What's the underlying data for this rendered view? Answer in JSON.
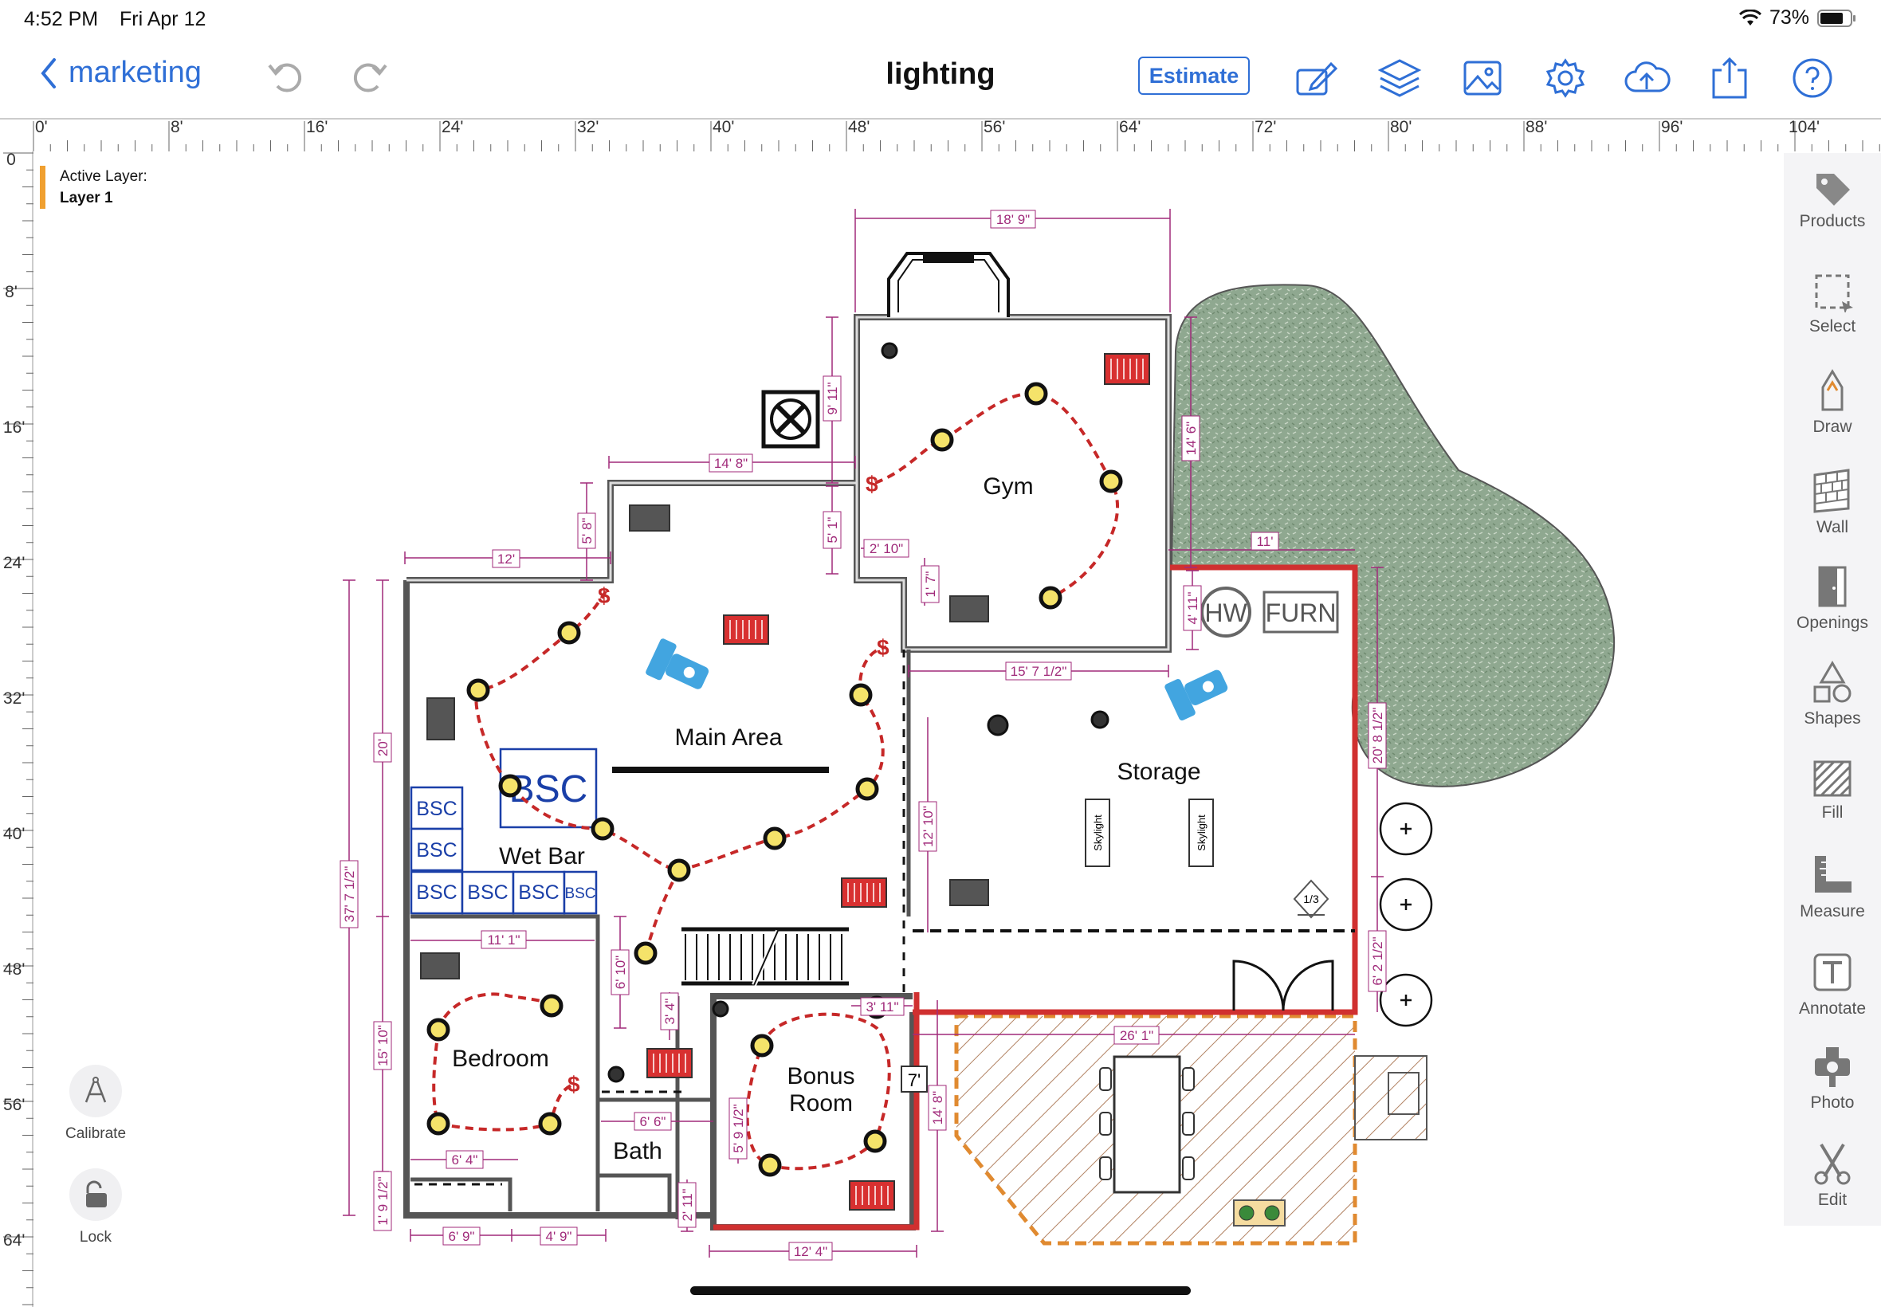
{
  "status_bar": {
    "time": "4:52 PM",
    "date": "Fri Apr 12",
    "battery": "73%"
  },
  "header": {
    "back_label": "marketing",
    "title": "lighting",
    "estimate_label": "Estimate"
  },
  "ruler": {
    "top_labels": [
      "0'",
      "8'",
      "16'",
      "24'",
      "32'",
      "40'",
      "48'",
      "56'",
      "64'",
      "72'",
      "80'",
      "88'",
      "96'",
      "104'"
    ],
    "left_labels": [
      "0",
      "8'",
      "16'",
      "24'",
      "32'",
      "40'",
      "48'",
      "56'",
      "64'"
    ]
  },
  "layer": {
    "caption": "Active Layer:",
    "name": "Layer 1"
  },
  "tools": [
    {
      "label": "Products",
      "icon": "tag-icon"
    },
    {
      "label": "Select",
      "icon": "select-icon"
    },
    {
      "label": "Draw",
      "icon": "pen-icon"
    },
    {
      "label": "Wall",
      "icon": "wall-icon"
    },
    {
      "label": "Openings",
      "icon": "door-icon"
    },
    {
      "label": "Shapes",
      "icon": "shapes-icon"
    },
    {
      "label": "Fill",
      "icon": "fill-icon"
    },
    {
      "label": "Measure",
      "icon": "ruler-icon"
    },
    {
      "label": "Annotate",
      "icon": "text-icon"
    },
    {
      "label": "Photo",
      "icon": "camera-icon"
    },
    {
      "label": "Edit",
      "icon": "scissors-icon"
    }
  ],
  "left_tools": {
    "calibrate": "Calibrate",
    "lock": "Lock"
  },
  "plan": {
    "rooms": {
      "gym": "Gym",
      "main": "Main Area",
      "storage": "Storage",
      "wet_bar": "Wet Bar",
      "bedroom": "Bedroom",
      "bonus_1": "Bonus",
      "bonus_2": "Room",
      "bath": "Bath"
    },
    "labels": {
      "hw": "HW",
      "furn": "FURN",
      "bsc": "BSC",
      "skylight": "Skylight",
      "fraction": "1/3",
      "seven": "7'"
    },
    "dims": [
      "18' 9\"",
      "9' 11\"",
      "14' 8\"",
      "5' 8\"",
      "5' 1\"",
      "12'",
      "2' 10\"",
      "1' 7\"",
      "14' 6\"",
      "11'",
      "4' 11\"",
      "15' 7 1/2\"",
      "20'",
      "20' 8 1/2\"",
      "12' 10\"",
      "37' 7 1/2\"",
      "11' 1\"",
      "6' 10\"",
      "3' 4\"",
      "3' 11\"",
      "6' 2 1/2\"",
      "26' 1\"",
      "15' 10\"",
      "6' 6\"",
      "5' 9 1/2\"",
      "14' 8\"",
      "6' 4\"",
      "1' 9 1/2\"",
      "2' 11\"",
      "6' 9\"",
      "4' 9\"",
      "12' 4\""
    ]
  }
}
